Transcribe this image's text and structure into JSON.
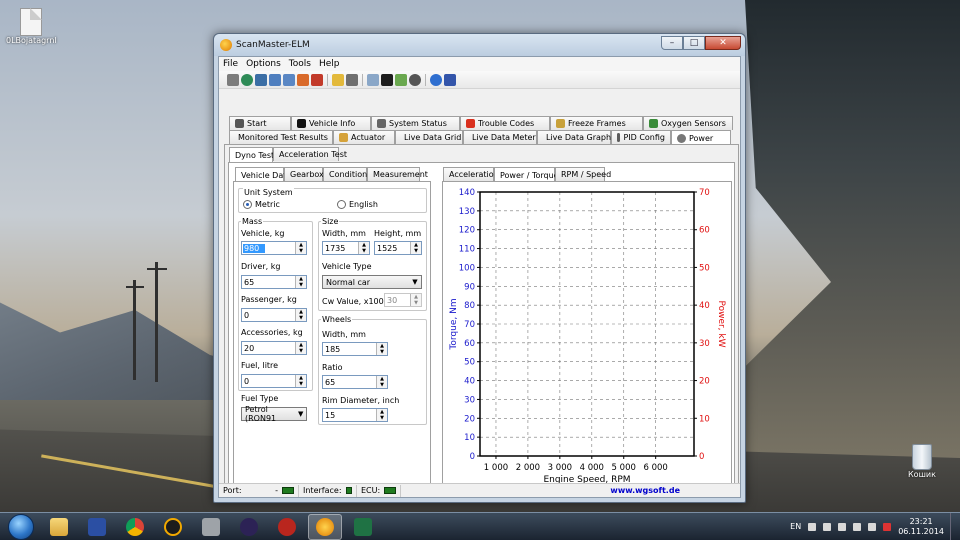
{
  "desktop": {
    "icons": [
      {
        "label": "0LBojatagrnl"
      },
      {
        "label": "Кошик"
      }
    ]
  },
  "window": {
    "title": "ScanMaster-ELM",
    "controls": {
      "minimize": "–",
      "maximize": "□",
      "close": "✕"
    }
  },
  "menu": [
    "File",
    "Options",
    "Tools",
    "Help"
  ],
  "tabs_row1": [
    {
      "label": "Start",
      "icon": "start-icon"
    },
    {
      "label": "Vehicle Info",
      "icon": "info-icon"
    },
    {
      "label": "System Status",
      "icon": "status-icon"
    },
    {
      "label": "Trouble Codes",
      "icon": "warning-icon"
    },
    {
      "label": "Freeze Frames",
      "icon": "freeze-icon"
    },
    {
      "label": "Oxygen Sensors",
      "icon": "oxygen-icon"
    }
  ],
  "tabs_row2": [
    {
      "label": "Monitored Test Results",
      "icon": "test-icon"
    },
    {
      "label": "Actuator",
      "icon": "actuator-icon"
    },
    {
      "label": "Live Data Grid",
      "icon": "grid-icon"
    },
    {
      "label": "Live Data Meter",
      "icon": "meter-icon"
    },
    {
      "label": "Live Data Graph",
      "icon": "graph-icon"
    },
    {
      "label": "PID Config",
      "icon": "config-icon"
    },
    {
      "label": "Power",
      "icon": "power-icon"
    }
  ],
  "subtabs": [
    "Dyno Test",
    "Acceleration Test"
  ],
  "left_tabs": [
    "Vehicle Data",
    "Gearbox",
    "Conditions",
    "Measurement"
  ],
  "right_tabs": [
    "Acceleration",
    "Power / Torque",
    "RPM / Speed"
  ],
  "form": {
    "unit_system": {
      "label": "Unit System",
      "metric": "Metric",
      "english": "English",
      "selected": "Metric"
    },
    "mass": {
      "label": "Mass",
      "vehicle_label": "Vehicle, kg",
      "vehicle_value": "980",
      "driver_label": "Driver, kg",
      "driver_value": "65",
      "passenger_label": "Passenger, kg",
      "passenger_value": "0",
      "accessories_label": "Accessories, kg",
      "accessories_value": "20",
      "fuel_label": "Fuel, litre",
      "fuel_value": "0",
      "fuel_type_label": "Fuel Type",
      "fuel_type_value": "Petrol (RON91"
    },
    "size": {
      "label": "Size",
      "width_label": "Width, mm",
      "width_value": "1735",
      "height_label": "Height, mm",
      "height_value": "1525",
      "vehicle_type_label": "Vehicle Type",
      "vehicle_type_value": "Normal car",
      "cw_label": "Cw Value, x100",
      "cw_value": "30"
    },
    "wheels": {
      "label": "Wheels",
      "width_label": "Width, mm",
      "width_value": "185",
      "ratio_label": "Ratio",
      "ratio_value": "65",
      "rim_label": "Rim Diameter, inch",
      "rim_value": "15"
    }
  },
  "chart_data": {
    "type": "line",
    "title": "",
    "xlabel": "Engine Speed, RPM",
    "ylabel": "Torque, Nm",
    "y2label": "Power, kW",
    "xlim": [
      500,
      7200
    ],
    "ylim": [
      0,
      140
    ],
    "y2lim": [
      0,
      70
    ],
    "x_ticks": [
      "1 000",
      "2 000",
      "3 000",
      "4 000",
      "5 000",
      "6 000"
    ],
    "x_tick_values": [
      1000,
      2000,
      3000,
      4000,
      5000,
      6000
    ],
    "y_ticks": [
      0,
      10,
      20,
      30,
      40,
      50,
      60,
      70,
      80,
      90,
      100,
      110,
      120,
      130,
      140
    ],
    "y2_ticks": [
      0,
      10,
      20,
      30,
      40,
      50,
      60,
      70
    ],
    "grid": true,
    "series": [],
    "colors": {
      "left_axis": "#1a1acc",
      "right_axis": "#e01010"
    }
  },
  "status": {
    "port_label": "Port:",
    "port_value": "-",
    "interface_label": "Interface:",
    "ecu_label": "ECU:",
    "site": "www.wgsoft.de"
  },
  "taskbar": {
    "lang": "EN",
    "time": "23:21",
    "date": "06.11.2014"
  }
}
